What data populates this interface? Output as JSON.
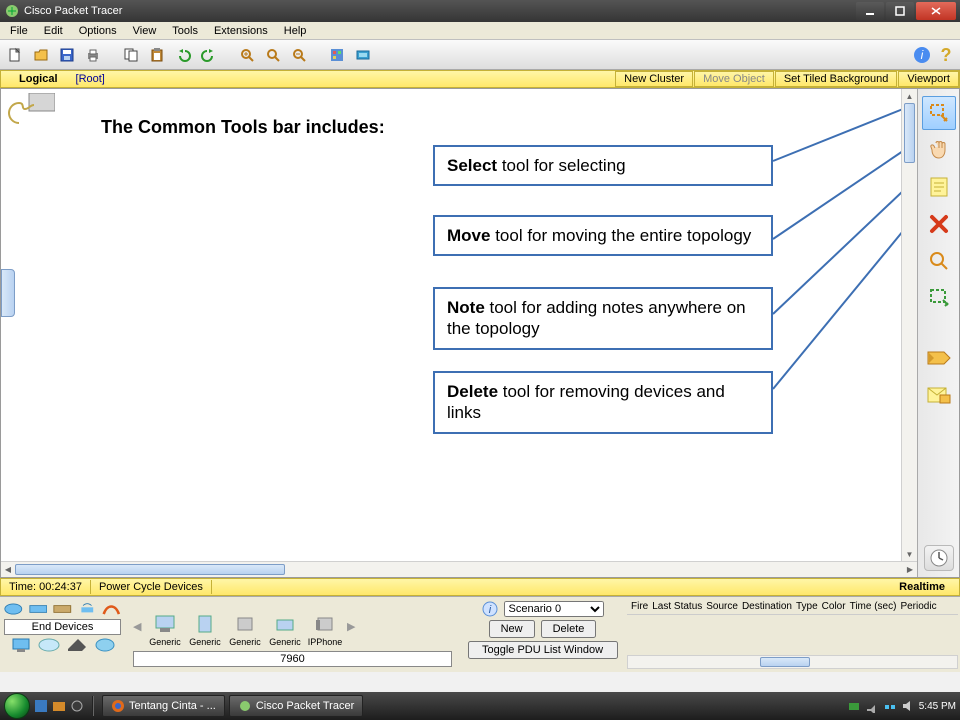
{
  "title": "Cisco Packet Tracer",
  "menu": [
    "File",
    "Edit",
    "Options",
    "View",
    "Tools",
    "Extensions",
    "Help"
  ],
  "logicbar": {
    "logical": "Logical",
    "root": "[Root]",
    "new_cluster": "New Cluster",
    "move_object": "Move Object",
    "set_tiled": "Set Tiled Background",
    "viewport": "Viewport"
  },
  "canvas": {
    "heading": "The Common Tools bar includes:",
    "callouts": [
      {
        "bold": "Select",
        "rest": " tool for selecting"
      },
      {
        "bold": "Move",
        "rest": " tool for moving the entire topology"
      },
      {
        "bold": "Note",
        "rest": " tool for adding notes anywhere on the topology"
      },
      {
        "bold": "Delete",
        "rest": " tool for removing devices and links"
      }
    ]
  },
  "right_tools": [
    "select-tool",
    "move-tool",
    "note-tool",
    "delete-tool",
    "zoom-tool",
    "draw-region-tool",
    "",
    "add-simple-pdu",
    "add-complex-pdu"
  ],
  "timebar": {
    "time": "Time: 00:24:37",
    "power": "Power Cycle Devices",
    "realtime": "Realtime"
  },
  "bottom": {
    "category_label": "End Devices",
    "devices": [
      {
        "label": "Generic"
      },
      {
        "label": "Generic"
      },
      {
        "label": "Generic"
      },
      {
        "label": "Generic"
      },
      {
        "label": "IPPhone"
      }
    ],
    "model": "7960",
    "scenario_label": "Scenario 0",
    "new_btn": "New",
    "delete_btn": "Delete",
    "toggle_btn": "Toggle PDU List Window",
    "pdu_cols": [
      "Fire",
      "Last Status",
      "Source",
      "Destination",
      "Type",
      "Color",
      "Time (sec)",
      "Periodic"
    ]
  },
  "taskbar": {
    "items": [
      {
        "icon": "firefox",
        "label": "Tentang Cinta - ..."
      },
      {
        "icon": "pt",
        "label": "Cisco Packet Tracer"
      }
    ],
    "clock": "5:45 PM"
  }
}
